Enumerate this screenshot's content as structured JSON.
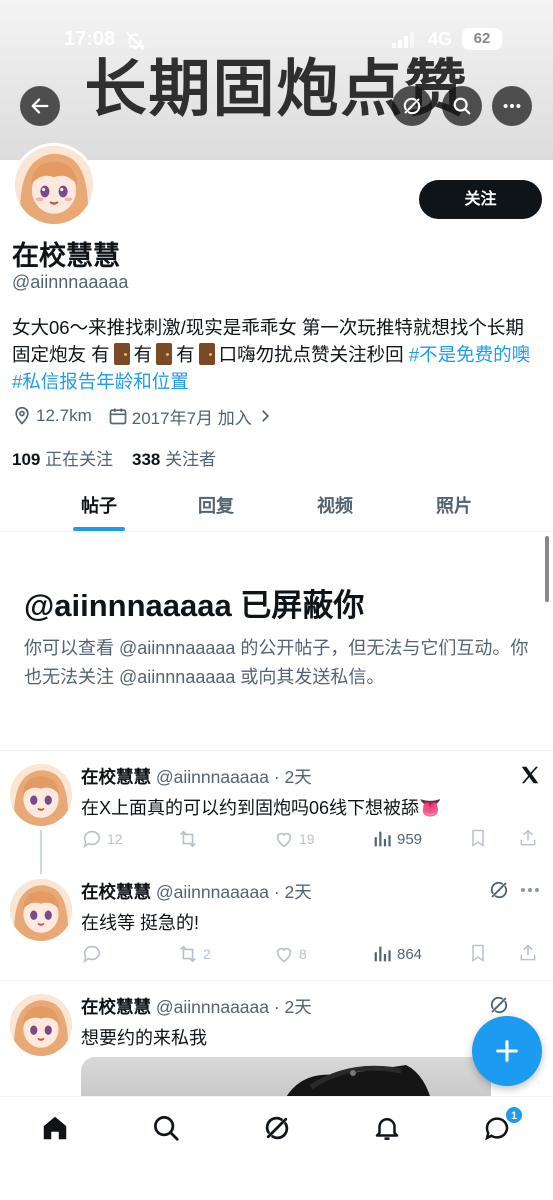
{
  "status_bar": {
    "time": "17:08",
    "network": "4G",
    "battery": "62"
  },
  "banner": {
    "overlay_text": "长期固炮点赞"
  },
  "header": {
    "back_icon": "arrow-left-icon",
    "grok_icon": "grok-icon",
    "search_icon": "search-icon",
    "more_icon": "more-icon"
  },
  "profile": {
    "name": "在校慧慧",
    "handle": "@aiinnnaaaaa",
    "follow_label": "关注",
    "bio_part1": "女大06～来推找刺激/现实是乖乖女 第一次玩推特就想找个长期固定炮友 有",
    "bio_part2": "有",
    "bio_part3": "有",
    "bio_part4": "口嗨勿扰点赞关注秒回",
    "bio_hashtag1": "#不是免费的噢",
    "bio_hashtag2": "#私信报告年龄和位置",
    "location": "12.7km",
    "joined": "2017年7月 加入",
    "following_count": "109",
    "following_label": "正在关注",
    "followers_count": "338",
    "followers_label": "关注者"
  },
  "tabs": [
    {
      "label": "帖子",
      "active": true
    },
    {
      "label": "回复",
      "active": false
    },
    {
      "label": "视频",
      "active": false
    },
    {
      "label": "照片",
      "active": false
    }
  ],
  "blocked": {
    "title": "@aiinnnaaaaa 已屏蔽你",
    "description": "你可以查看 @aiinnnaaaaa 的公开帖子，但无法与它们互动。你也无法关注 @aiinnnaaaaa 或向其发送私信。"
  },
  "posts": [
    {
      "name": "在校慧慧",
      "meta": "@aiinnnaaaaa · 2天",
      "text": "在X上面真的可以约到固炮吗06线下想被舔👅",
      "replies": "12",
      "retweets": "",
      "likes": "19",
      "views": "959",
      "corner_icon": "x-logo-icon"
    },
    {
      "name": "在校慧慧",
      "meta": "@aiinnnaaaaa · 2天",
      "text": "在线等 挺急的!",
      "replies": "",
      "retweets": "2",
      "likes": "8",
      "views": "864",
      "corner_icon": "grok-icon"
    },
    {
      "name": "在校慧慧",
      "meta": "@aiinnnaaaaa · 2天",
      "text": "想要约的来私我",
      "corner_icon": "grok-icon"
    }
  ],
  "fab": {
    "icon": "plus-icon"
  },
  "bottom_nav": {
    "items": [
      "home-icon",
      "search-icon",
      "grok-icon",
      "bell-icon",
      "messages-icon"
    ],
    "messages_badge": "1"
  },
  "colors": {
    "accent": "#1d9bf0",
    "text": "#0f1419",
    "secondary": "#536471"
  }
}
